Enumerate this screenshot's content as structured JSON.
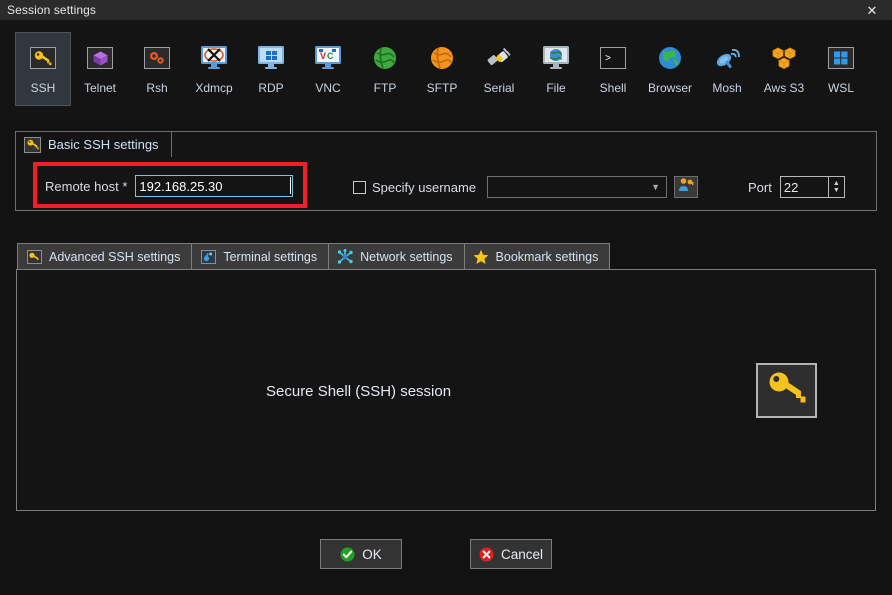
{
  "window": {
    "title": "Session settings",
    "close_label": "✕"
  },
  "session_types": [
    {
      "label": "SSH",
      "icon": "key-icon",
      "selected": true
    },
    {
      "label": "Telnet",
      "icon": "cube-icon",
      "selected": false
    },
    {
      "label": "Rsh",
      "icon": "gears-icon",
      "selected": false
    },
    {
      "label": "Xdmcp",
      "icon": "xserver-icon",
      "selected": false
    },
    {
      "label": "RDP",
      "icon": "windows-monitor-icon",
      "selected": false
    },
    {
      "label": "VNC",
      "icon": "vnc-monitor-icon",
      "selected": false
    },
    {
      "label": "FTP",
      "icon": "green-globe-icon",
      "selected": false
    },
    {
      "label": "SFTP",
      "icon": "orange-globe-icon",
      "selected": false
    },
    {
      "label": "Serial",
      "icon": "serial-plug-icon",
      "selected": false
    },
    {
      "label": "File",
      "icon": "file-monitor-icon",
      "selected": false
    },
    {
      "label": "Shell",
      "icon": "shell-prompt-icon",
      "selected": false
    },
    {
      "label": "Browser",
      "icon": "blue-globe-icon",
      "selected": false
    },
    {
      "label": "Mosh",
      "icon": "satellite-icon",
      "selected": false
    },
    {
      "label": "Aws S3",
      "icon": "aws-cubes-icon",
      "selected": false
    },
    {
      "label": "WSL",
      "icon": "windows-logo-icon",
      "selected": false
    }
  ],
  "basic_group": {
    "tab_label": "Basic SSH settings",
    "tab_icon": "key-icon",
    "remote_host_label": "Remote host *",
    "remote_host_value": "192.168.25.30",
    "specify_username_label": "Specify username",
    "specify_username_checked": false,
    "username_value": "",
    "username_combo_icon": "chevron-down-icon",
    "user_key_button_icon": "user-key-icon",
    "port_label": "Port",
    "port_value": "22",
    "highlight_color": "#f01e28"
  },
  "settings_tabs": [
    {
      "label": "Advanced SSH settings",
      "icon": "key-icon"
    },
    {
      "label": "Terminal settings",
      "icon": "terminal-icon"
    },
    {
      "label": "Network settings",
      "icon": "network-nodes-icon"
    },
    {
      "label": "Bookmark settings",
      "icon": "star-icon"
    }
  ],
  "content": {
    "caption": "Secure Shell (SSH) session",
    "badge_icon": "key-icon"
  },
  "footer": {
    "ok_label": "OK",
    "cancel_label": "Cancel",
    "ok_icon": "green-check-icon",
    "cancel_icon": "red-x-icon"
  }
}
